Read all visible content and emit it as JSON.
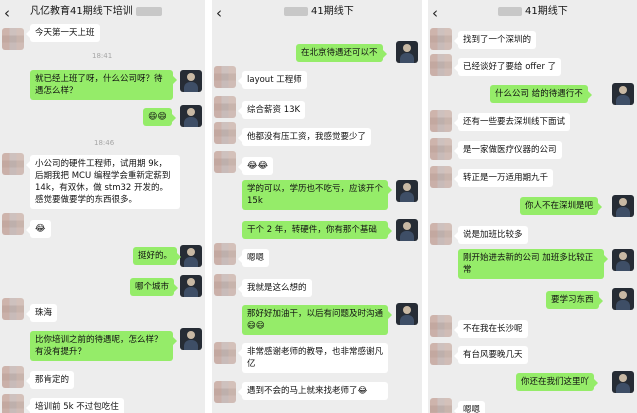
{
  "panel1": {
    "title": "凡亿教育41期线下培训",
    "timestamps": [
      "18:41",
      "18:46"
    ],
    "messages": [
      "今天第一天上班",
      "就已经上班了呀，什么公司呀？待遇怎么样？",
      "😄😄",
      "小公司的硬件工程师，试用期 9k，后期我把 MCU 编程学会重新定薪到 14k，有双休，做 stm32 开发的。感觉要做要学的东西很多。",
      "😂",
      "挺好的。",
      "哪个城市",
      "珠海",
      "比你培训之前的待遇呢，怎么样？有没有提升？",
      "那肯定的",
      "培训前 5k 不过包吃住"
    ]
  },
  "panel2": {
    "title": "41期线下",
    "messages": [
      "在北京待遇还可以不",
      "layout 工程师",
      "综合薪资 13K",
      "他都没有压工资，我感觉要少了",
      "😂😂",
      "学的可以，学历也不吃亏，应该开个 15k",
      "干个 2 年，转硬件，你有那个基础",
      "嗯嗯",
      "我就是这么想的",
      "那好好加油干，以后有问题及时沟通😄😄",
      "非常感谢老师的教导，也非常感谢凡亿",
      "遇到不会的马上就来找老师了😂"
    ]
  },
  "panel3": {
    "title": "41期线下",
    "messages": [
      "找到了一个深圳的",
      "已经谈好了要给 offer 了",
      "什么公司 给的待遇行不",
      "还有一些要去深圳线下面试",
      "是一家做医疗仪器的公司",
      "转正是一万适用期九千",
      "你人不在深圳是吧",
      "说是加班比较多",
      "刚开始进去新的公司 加班多比较正常",
      "要学习东西",
      "不在我在长沙呢",
      "有台风要晚几天",
      "你还在我们这里吖",
      "嗯嗯"
    ]
  },
  "icons": {
    "back": "back-arrow-icon"
  },
  "colors": {
    "sent_bubble": "#95ec69",
    "received_bubble": "#ffffff",
    "background": "#ededed"
  }
}
